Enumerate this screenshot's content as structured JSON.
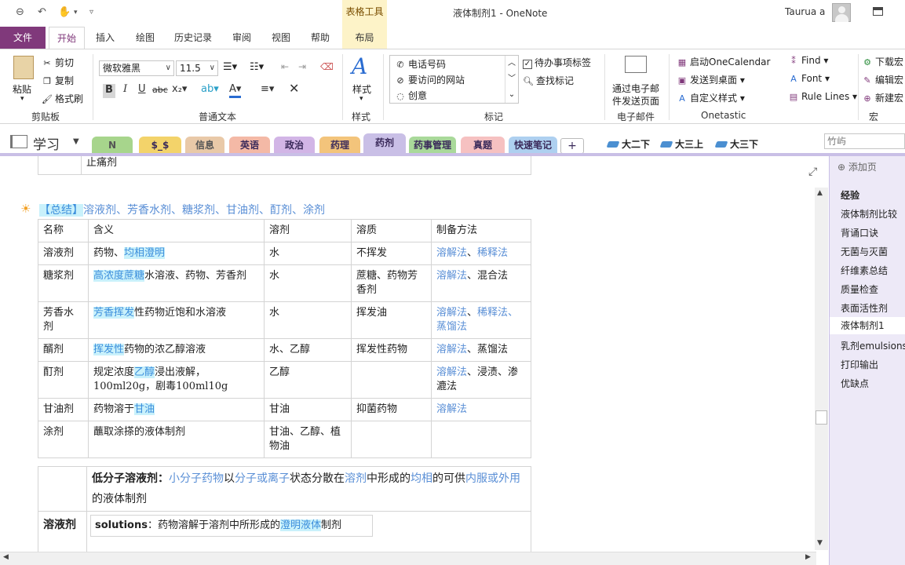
{
  "titlebar": {
    "context_tab_label": "表格工具",
    "window_title": "液体制剂1  -  OneNote",
    "user_name": "Taurua a"
  },
  "ribbon_tabs": [
    "文件",
    "开始",
    "插入",
    "绘图",
    "历史记录",
    "审阅",
    "视图",
    "帮助",
    "布局"
  ],
  "ribbon": {
    "clipboard": {
      "paste": "粘贴",
      "cut": "剪切",
      "copy": "复制",
      "format_painter": "格式刷",
      "group": "剪贴板"
    },
    "basic_text": {
      "font": "微软雅黑",
      "size": "11.5",
      "group": "普通文本"
    },
    "styles": {
      "label": "样式",
      "group": "样式"
    },
    "tags": {
      "items": [
        "电话号码",
        "要访问的网站",
        "创意"
      ],
      "todo": "待办事项标签",
      "find": "查找标记",
      "group": "标记"
    },
    "email": {
      "label_line1": "通过电子邮",
      "label_line2": "件发送页面",
      "group": "电子邮件"
    },
    "onetastic": {
      "items": [
        "启动OneCalendar",
        "发送到桌面",
        "自定义样式"
      ],
      "find": "Find",
      "font": "Font",
      "rule_lines": "Rule Lines",
      "group": "Onetastic"
    },
    "macros": {
      "items": [
        "下载宏",
        "编辑宏",
        "新建宏"
      ],
      "group": "宏"
    }
  },
  "notebook": {
    "name": "学习",
    "sections": [
      {
        "label": "N",
        "color": "#a7d58c"
      },
      {
        "label": "$_$",
        "color": "#f3d36a"
      },
      {
        "label": "信息",
        "color": "#e9c9a8"
      },
      {
        "label": "英语",
        "color": "#f4b9a6"
      },
      {
        "label": "政治",
        "color": "#d2b5e6"
      },
      {
        "label": "药理",
        "color": "#f3c47b"
      },
      {
        "label": "药剂",
        "color": "#c9bfe6"
      },
      {
        "label": "药事管理",
        "color": "#a9d99a"
      },
      {
        "label": "真题",
        "color": "#f6c1c1"
      },
      {
        "label": "快速笔记",
        "color": "#aed0f0"
      },
      {
        "label": "+",
        "color": "#ffffff"
      }
    ],
    "section_groups": [
      "大二下",
      "大三上",
      "大三下"
    ],
    "search_placeholder": "竹屿"
  },
  "page": {
    "top_cell": "止痛剂",
    "summary_prefix": "【总结】",
    "summary_rest": "溶液剂、芳香水剂、糖浆剂、甘油剂、酊剂、涂剂",
    "table_headers": [
      "名称",
      "含义",
      "溶剂",
      "溶质",
      "制备方法"
    ],
    "rows": [
      {
        "name": "溶液剂",
        "m1": "药物、",
        "m2": "均相澄明",
        "m3": "",
        "solvent": "水",
        "solute": "不挥发",
        "p1": "溶解法",
        "p2": "、",
        "p3": "稀释法"
      },
      {
        "name": "糖浆剂",
        "m1": "",
        "m2": "高浓度蔗糖",
        "m3": "水溶液、药物、芳香剂",
        "solvent": "水",
        "solute": "蔗糖、药物芳香剂",
        "p1": "溶解法",
        "p2": "、混合法",
        "p3": ""
      },
      {
        "name": "芳香水剂",
        "m1": "",
        "m2": "芳香挥发",
        "m3": "性药物近饱和水溶液",
        "solvent": "水",
        "solute": "挥发油",
        "p1": "溶解法",
        "p2": "、",
        "p3": "稀释法、蒸馏法"
      },
      {
        "name": "醑剂",
        "m1": "",
        "m2": "挥发性",
        "m3": "药物的浓乙醇溶液",
        "solvent": "水、乙醇",
        "solute": "挥发性药物",
        "p1": "溶解法",
        "p2": "、蒸馏法",
        "p3": ""
      },
      {
        "name": "酊剂",
        "m1": "规定浓度",
        "m2": "乙醇",
        "m3": "浸出液解，100ml20g，剧毒100ml10g",
        "solvent": "乙醇",
        "solute": "",
        "p1": "溶解法",
        "p2": "、浸渍、渗漉法",
        "p3": ""
      },
      {
        "name": "甘油剂",
        "m1": "药物溶于",
        "m2": "甘油",
        "m3": "",
        "solvent": "甘油",
        "solute": "抑菌药物",
        "p1": "溶解法",
        "p2": "",
        "p3": ""
      },
      {
        "name": "涂剂",
        "m1": "蘸取涂搽的液体制剂",
        "m2": "",
        "m3": "",
        "solvent": "甘油、乙醇、植物油",
        "solute": "",
        "p1": "",
        "p2": "",
        "p3": ""
      }
    ],
    "lower": {
      "lead": "低分子溶液剂：",
      "def_a": "小分子药物",
      "def_b": "以",
      "def_c": "分子或离子",
      "def_d": "状态分散在",
      "def_e": "溶剂",
      "def_f": "中形成的",
      "def_g": "均相",
      "def_h": "的可供",
      "def_i": "内服或外用",
      "def_j": "的液体制剂",
      "row_label": "溶液剂",
      "inner_a": "solutions",
      "inner_b": "：药物溶解于溶剂中所形成的",
      "inner_c": "澄明液体",
      "inner_d": "制剂"
    }
  },
  "pages_pane": {
    "add_page": "添加页",
    "pages": [
      "经验",
      "液体制剂比较",
      "背诵口诀",
      "无菌与灭菌",
      "纤维素总结",
      "质量检查",
      "表面活性剂",
      "液体制剂1",
      "乳剂emulsions",
      "打印输出",
      "优缺点"
    ],
    "selected": "液体制剂1"
  }
}
